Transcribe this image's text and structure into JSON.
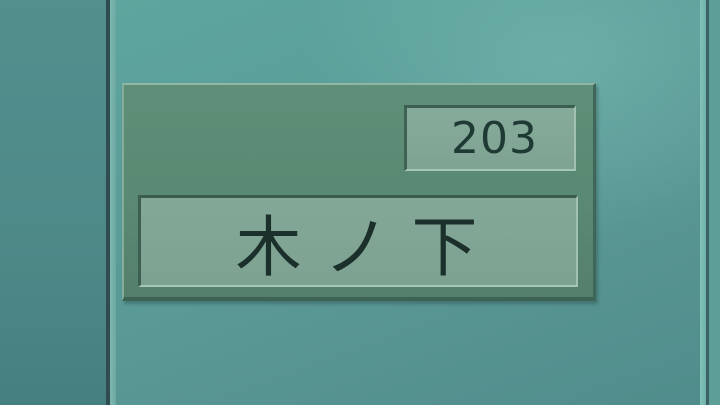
{
  "nameplate": {
    "room_number": "203",
    "resident_name": "木ノ下"
  },
  "colors": {
    "wall": "#5b9e99",
    "plate": "#5a8973",
    "window": "#80a594",
    "text": "#1f3a34"
  }
}
